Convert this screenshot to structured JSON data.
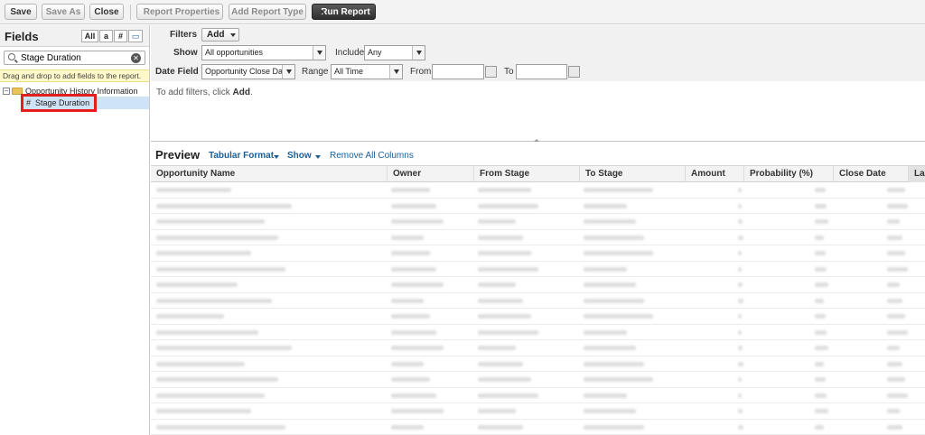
{
  "toolbar": {
    "save": "Save",
    "save_as": "Save As",
    "close": "Close",
    "report_properties": "Report Properties",
    "add_report_type": "Add Report Type",
    "run_report": "Run Report"
  },
  "fields_panel": {
    "title": "Fields",
    "toggles": [
      "All",
      "a",
      "#",
      "▭"
    ],
    "search_value": "Stage Duration",
    "hint": "Drag and drop to add fields to the report.",
    "folder": "Opportunity History Information",
    "item_symbol": "#",
    "item": "Stage Duration"
  },
  "filters": {
    "label": "Filters",
    "add": "Add",
    "show_label": "Show",
    "show_value": "All opportunities",
    "include_label": "Include",
    "include_value": "Any",
    "date_field_label": "Date Field",
    "date_field_value": "Opportunity Close Da",
    "range_label": "Range",
    "range_value": "All Time",
    "from_label": "From",
    "to_label": "To",
    "note_prefix": "To add filters, click ",
    "note_bold": "Add",
    "note_suffix": "."
  },
  "preview": {
    "title": "Preview",
    "format": "Tabular Format",
    "show": "Show",
    "remove_all": "Remove All Columns",
    "columns": [
      "Opportunity Name",
      "Owner",
      "From Stage",
      "To Stage",
      "Amount",
      "Probability (%)",
      "Close Date",
      "Las"
    ]
  },
  "colors": {
    "highlight": "#e41e1e",
    "link": "#1b5e96",
    "selected_row": "#cfe3f7",
    "hint_bg": "#fff8c8"
  }
}
